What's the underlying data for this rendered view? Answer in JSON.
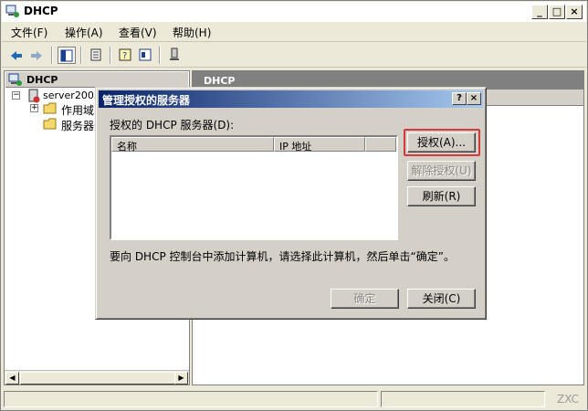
{
  "window": {
    "title": "DHCP",
    "minimize": "_",
    "maximize": "□",
    "close": "×"
  },
  "menu": [
    "文件(F)",
    "操作(A)",
    "查看(V)",
    "帮助(H)"
  ],
  "toolbar": {
    "back_icon": "arrow-left-icon",
    "forward_icon": "arrow-right-icon"
  },
  "tree": {
    "root": "DHCP",
    "server": "server2003",
    "scope": "作用域",
    "server_options": "服务器选项"
  },
  "detail": {
    "header": "DHCP"
  },
  "dialog": {
    "title": "管理授权的服务器",
    "help": "?",
    "close": "×",
    "list_label": "授权的 DHCP 服务器(D):",
    "columns": [
      "名称",
      "IP 地址"
    ],
    "buttons": {
      "authorize": "授权(A)...",
      "unauthorize": "解除授权(U)",
      "refresh": "刷新(R)",
      "ok": "确定",
      "close": "关闭(C)"
    },
    "hint": "要向 DHCP 控制台中添加计算机，请选择此计算机，然后单击“确定”。"
  },
  "watermark": "ZXC",
  "colors": {
    "highlight": "#d23a3a",
    "dialog_title_start": "#0a246a",
    "dialog_title_end": "#a6caf0"
  }
}
